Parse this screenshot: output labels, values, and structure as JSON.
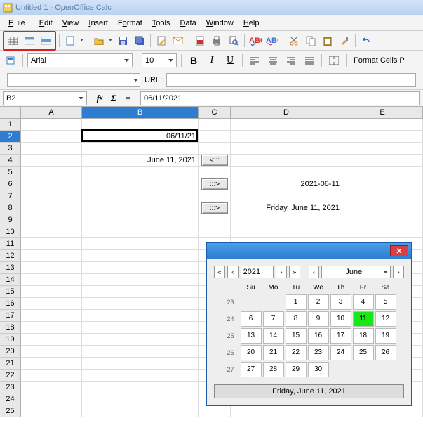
{
  "title": "Untitled 1 - OpenOffice Calc",
  "menu": {
    "file": "File",
    "edit": "Edit",
    "view": "View",
    "insert": "Insert",
    "format": "Format",
    "tools": "Tools",
    "data": "Data",
    "window": "Window",
    "help": "Help"
  },
  "format_bar": {
    "font": "Arial",
    "size": "10",
    "format_cells": "Format Cells  P"
  },
  "url": {
    "label": "URL:"
  },
  "formula": {
    "cellref": "B2",
    "eq": "=",
    "value": "06/11/2021"
  },
  "columns": [
    {
      "id": "A",
      "w": 87
    },
    {
      "id": "B",
      "w": 166,
      "sel": true
    },
    {
      "id": "C",
      "w": 46
    },
    {
      "id": "D",
      "w": 159
    },
    {
      "id": "E",
      "w": 115
    }
  ],
  "rows": [
    1,
    2,
    3,
    4,
    5,
    6,
    7,
    8,
    9,
    10,
    11,
    12,
    13,
    14,
    15,
    16,
    17,
    18,
    19,
    20,
    21,
    22,
    23,
    24,
    25
  ],
  "sel_row": 2,
  "cells": {
    "B2": "06/11/21",
    "B4": "June 11, 2021",
    "C4": "<:::",
    "C6": ":::>",
    "D6": "2021-06-11",
    "C8": ":::>",
    "D8": "Friday, June 11, 2021"
  },
  "cursor": {
    "col": "B",
    "row": 2
  },
  "calendar": {
    "year": "2021",
    "month": "June",
    "day_heads": [
      "Su",
      "Mo",
      "Tu",
      "We",
      "Th",
      "Fr",
      "Sa"
    ],
    "weeks": [
      {
        "wk": "23",
        "days": [
          "",
          "",
          "1",
          "2",
          "3",
          "4",
          "5"
        ]
      },
      {
        "wk": "24",
        "days": [
          "6",
          "7",
          "8",
          "9",
          "10",
          "11",
          "12"
        ],
        "today_idx": 5
      },
      {
        "wk": "25",
        "days": [
          "13",
          "14",
          "15",
          "16",
          "17",
          "18",
          "19"
        ]
      },
      {
        "wk": "26",
        "days": [
          "20",
          "21",
          "22",
          "23",
          "24",
          "25",
          "26"
        ]
      },
      {
        "wk": "27",
        "days": [
          "27",
          "28",
          "29",
          "30",
          "",
          "",
          ""
        ]
      }
    ],
    "banner": "Friday, June 11, 2021"
  },
  "chart_data": null
}
